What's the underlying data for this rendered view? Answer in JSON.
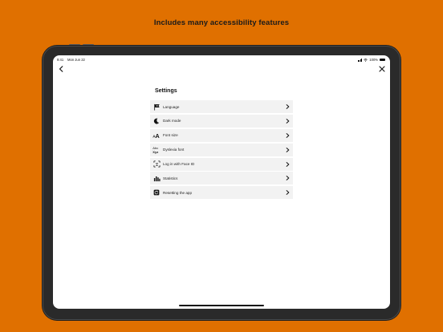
{
  "headline": "Includes many accessibility features",
  "status_bar": {
    "time": "9:41",
    "date": "Mon Jun 22",
    "battery": "100%"
  },
  "settings": {
    "title": "Settings",
    "items": [
      {
        "label": "Language",
        "icon": "flag-icon"
      },
      {
        "label": "Dark mode",
        "icon": "moon-icon"
      },
      {
        "label": "Font size",
        "icon": "font-size-icon"
      },
      {
        "label": "Dyslexia font",
        "icon": "dyslexia-font-icon"
      },
      {
        "label": "Log in with Face ID",
        "icon": "face-id-icon"
      },
      {
        "label": "Statistics",
        "icon": "bar-chart-icon"
      },
      {
        "label": "Resetting the app",
        "icon": "reset-icon"
      }
    ]
  },
  "colors": {
    "background": "#e07000",
    "screen": "#ffffff",
    "row": "#f2f2f2"
  }
}
